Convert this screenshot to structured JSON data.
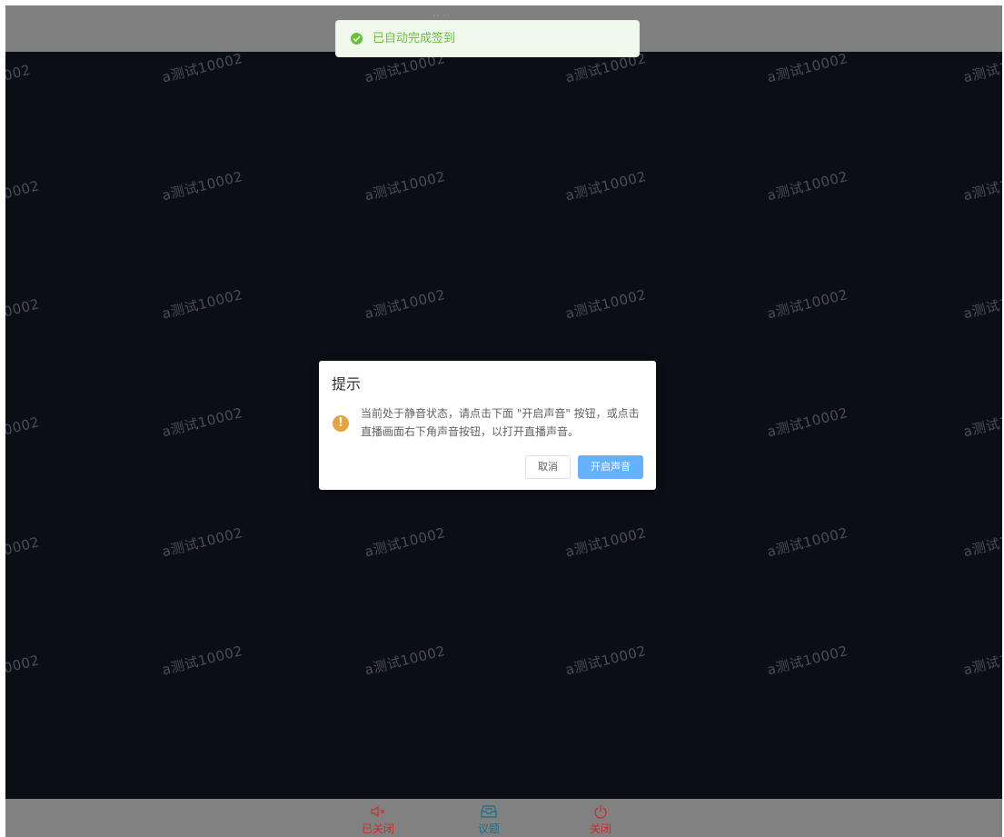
{
  "top_bar": {
    "title_fragment": "··  ··"
  },
  "watermark": {
    "text": "a测试10002",
    "partial_left": "0002",
    "partial_left_short": "002",
    "partial_right": "a测试1"
  },
  "toast": {
    "message": "已自动完成签到",
    "color": "#67c23a"
  },
  "dialog": {
    "title": "提示",
    "message": "当前处于静音状态，请点击下面 \"开启声音\" 按钮，或点击直播画面右下角声音按钮，以打开直播声音。",
    "cancel_label": "取消",
    "confirm_label": "开启声音",
    "warning_color": "#e6a23c",
    "confirm_color": "#66b1ff"
  },
  "bottom_bar": {
    "mic_label": "已关闭",
    "topics_label": "议题",
    "close_label": "关闭",
    "mic_color": "#c6302b",
    "topics_color": "#1f6f88"
  }
}
